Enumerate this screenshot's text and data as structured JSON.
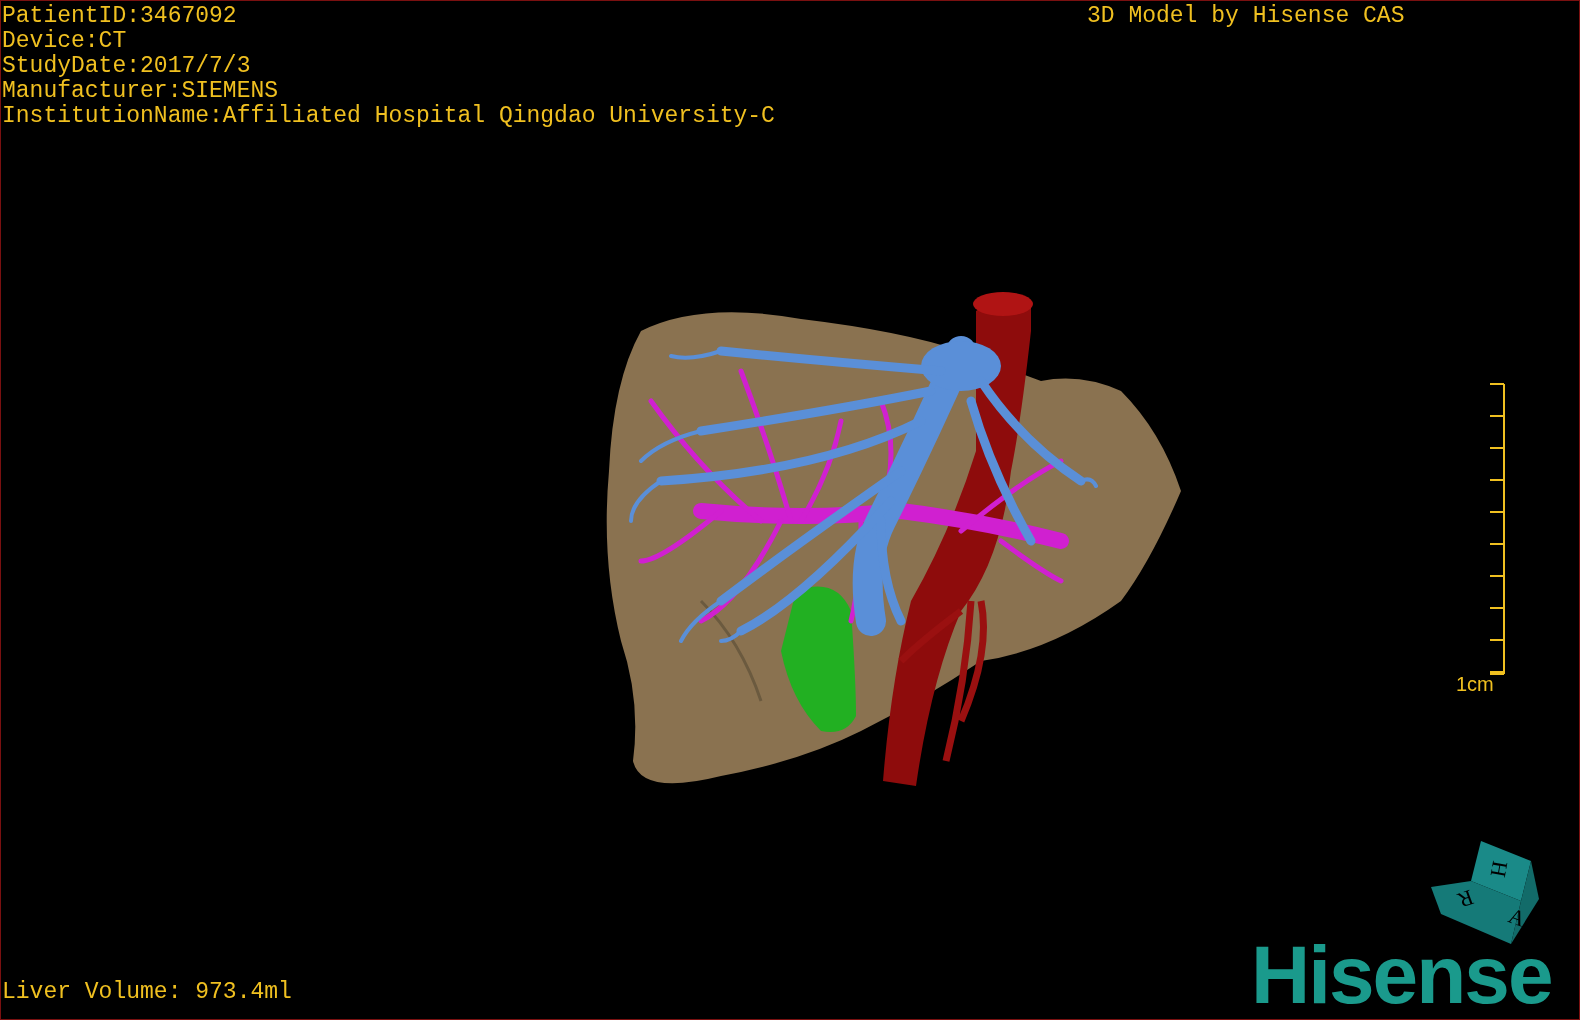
{
  "overlay": {
    "info_lines": [
      "PatientID:3467092",
      "Device:CT",
      "StudyDate:2017/7/3",
      "Manufacturer:SIEMENS",
      "InstitutionName:Affiliated Hospital Qingdao University-C"
    ],
    "title": "3D Model by Hisense CAS",
    "scale_label": "1cm",
    "liver_volume": "Liver Volume: 973.4ml"
  },
  "orientation_cube": {
    "faces": [
      "H",
      "R",
      "A"
    ]
  },
  "logo": "Hisense"
}
